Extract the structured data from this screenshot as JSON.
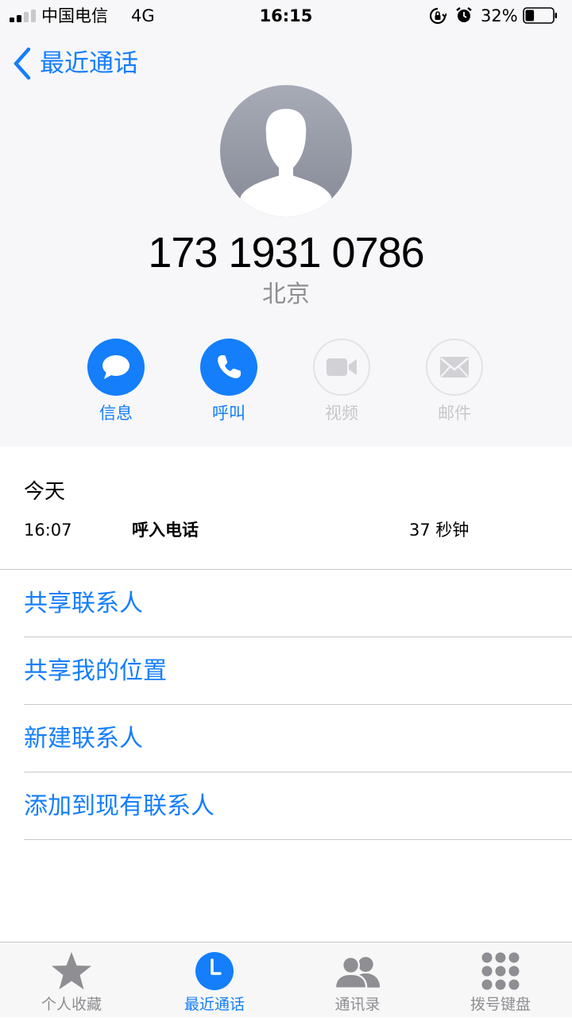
{
  "status_bar": {
    "carrier": "中国电信",
    "network": "4G",
    "time": "16:15",
    "battery_percent": "32%",
    "battery_level": 0.32
  },
  "nav": {
    "back_label": "最近通话",
    "back_icon": "chevron-left-icon"
  },
  "contact": {
    "avatar_icon": "person-silhouette-icon",
    "phone_number": "173 1931 0786",
    "location": "北京"
  },
  "actions": [
    {
      "label": "信息",
      "icon": "message-bubble-icon",
      "enabled": true
    },
    {
      "label": "呼叫",
      "icon": "phone-icon",
      "enabled": true
    },
    {
      "label": "视频",
      "icon": "video-camera-icon",
      "enabled": false
    },
    {
      "label": "邮件",
      "icon": "mail-icon",
      "enabled": false
    }
  ],
  "call_log": {
    "date_heading": "今天",
    "entries": [
      {
        "time": "16:07",
        "type": "呼入电话",
        "duration": "37 秒钟"
      }
    ]
  },
  "options": [
    {
      "label": "共享联系人"
    },
    {
      "label": "共享我的位置"
    },
    {
      "label": "新建联系人"
    },
    {
      "label": "添加到现有联系人"
    }
  ],
  "tabs": [
    {
      "label": "个人收藏",
      "icon": "star-icon",
      "active": false
    },
    {
      "label": "最近通话",
      "icon": "clock-icon",
      "active": true
    },
    {
      "label": "通讯录",
      "icon": "contacts-icon",
      "active": false
    },
    {
      "label": "拨号键盘",
      "icon": "keypad-icon",
      "active": false
    }
  ],
  "colors": {
    "accent": "#147efb",
    "secondary_text": "#8e8e93",
    "disabled": "#c7c7cc",
    "header_background": "#f7f7f9"
  }
}
